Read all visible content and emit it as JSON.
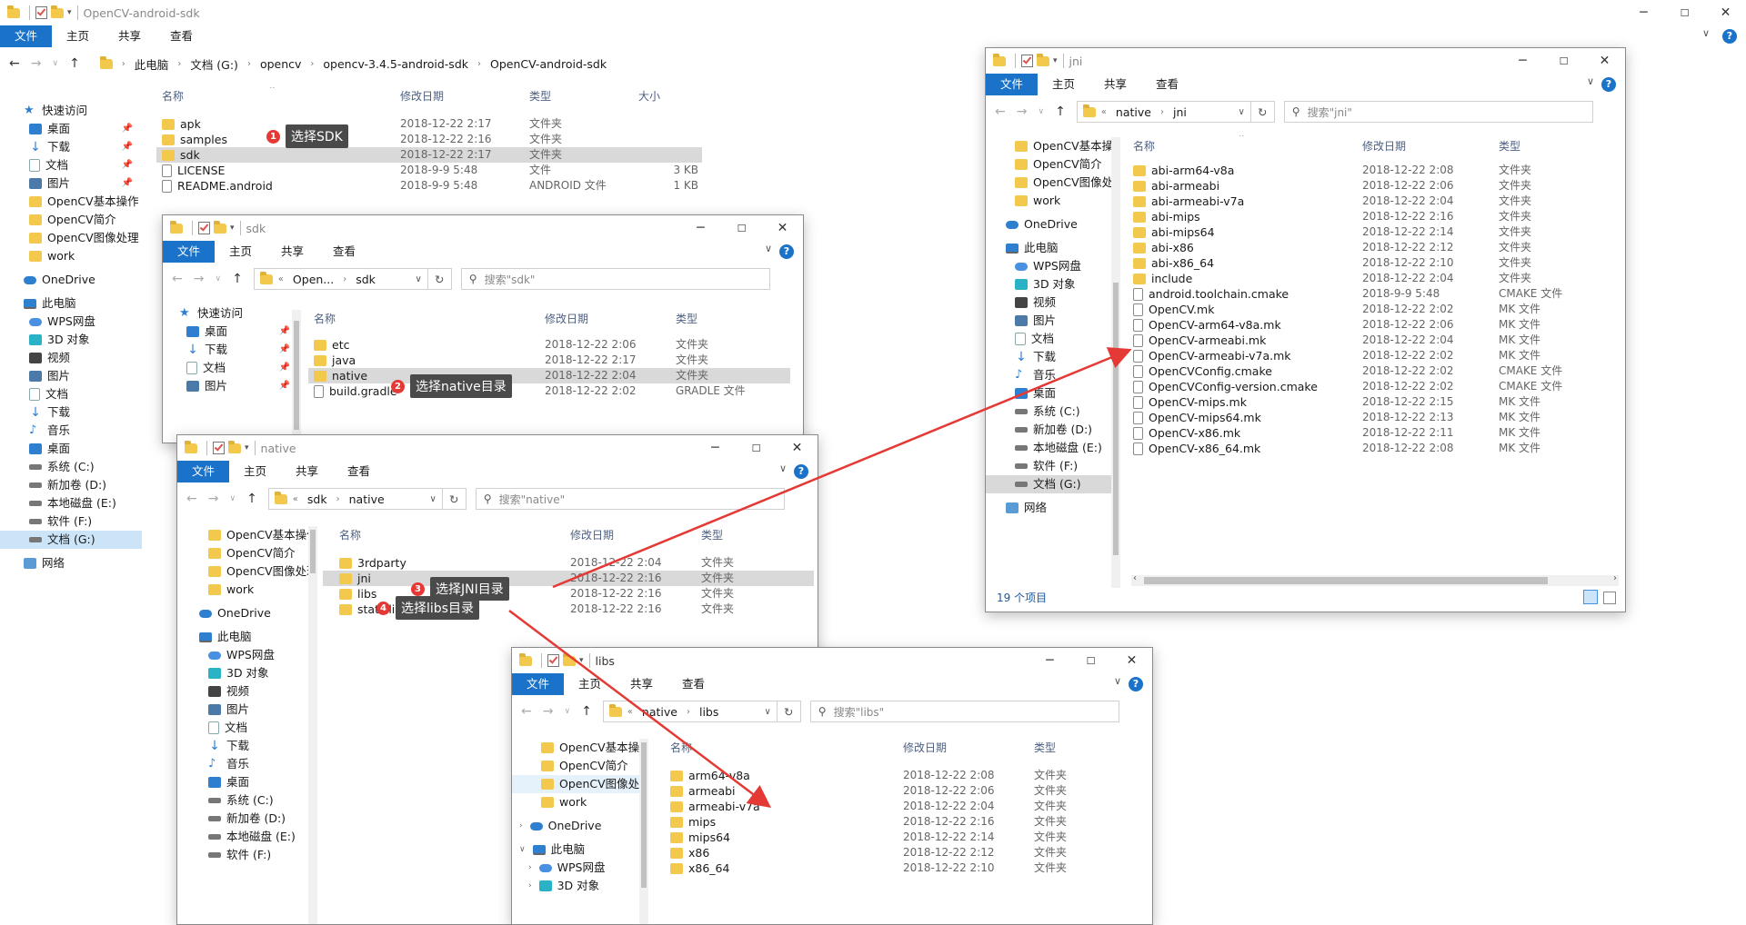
{
  "common": {
    "tab_file": "文件",
    "tab_home": "主页",
    "tab_share": "共享",
    "tab_view": "查看",
    "ctrl_min": "─",
    "ctrl_max": "☐",
    "ctrl_close": "✕"
  },
  "w1": {
    "title": "OpenCV-android-sdk",
    "crumbs": [
      "此电脑",
      "文档 (G:)",
      "opencv",
      "opencv-3.4.5-android-sdk",
      "OpenCV-android-sdk"
    ],
    "headers": {
      "name": "名称",
      "date": "修改日期",
      "type": "类型",
      "size": "大小"
    },
    "rows": [
      {
        "name": "apk",
        "date": "2018-12-22 2:17",
        "type": "文件夹",
        "size": ""
      },
      {
        "name": "samples",
        "date": "2018-12-22 2:16",
        "type": "文件夹",
        "size": ""
      },
      {
        "name": "sdk",
        "date": "2018-12-22 2:17",
        "type": "文件夹",
        "size": ""
      },
      {
        "name": "LICENSE",
        "date": "2018-9-9 5:48",
        "type": "文件",
        "size": "3 KB"
      },
      {
        "name": "README.android",
        "date": "2018-9-9 5:48",
        "type": "ANDROID 文件",
        "size": "1 KB"
      }
    ],
    "nav": [
      "快速访问",
      "桌面",
      "下载",
      "文档",
      "图片",
      "OpenCV基本操作",
      "OpenCV简介",
      "OpenCV图像处理",
      "work",
      "OneDrive",
      "此电脑",
      "WPS网盘",
      "3D 对象",
      "视频",
      "图片",
      "文档",
      "下载",
      "音乐",
      "桌面",
      "系统 (C:)",
      "新加卷 (D:)",
      "本地磁盘 (E:)",
      "软件 (F:)",
      "文档 (G:)",
      "网络"
    ]
  },
  "w2": {
    "title": "sdk",
    "crumbs": [
      "Open...",
      "sdk"
    ],
    "search": "搜索\"sdk\"",
    "headers": {
      "name": "名称",
      "date": "修改日期",
      "type": "类型"
    },
    "rows": [
      {
        "name": "etc",
        "date": "2018-12-22 2:06",
        "type": "文件夹"
      },
      {
        "name": "java",
        "date": "2018-12-22 2:17",
        "type": "文件夹"
      },
      {
        "name": "native",
        "date": "2018-12-22 2:04",
        "type": "文件夹"
      },
      {
        "name": "build.gradle",
        "date": "2018-12-22 2:02",
        "type": "GRADLE 文件"
      }
    ],
    "nav": [
      "快速访问",
      "桌面",
      "下载",
      "文档",
      "图片"
    ]
  },
  "w3": {
    "title": "native",
    "crumbs": [
      "sdk",
      "native"
    ],
    "search": "搜索\"native\"",
    "headers": {
      "name": "名称",
      "date": "修改日期",
      "type": "类型"
    },
    "rows": [
      {
        "name": "3rdparty",
        "date": "2018-12-22 2:04",
        "type": "文件夹"
      },
      {
        "name": "jni",
        "date": "2018-12-22 2:16",
        "type": "文件夹"
      },
      {
        "name": "libs",
        "date": "2018-12-22 2:16",
        "type": "文件夹"
      },
      {
        "name": "staticlibs",
        "date": "2018-12-22 2:16",
        "type": "文件夹"
      }
    ],
    "nav": [
      "OpenCV基本操作",
      "OpenCV简介",
      "OpenCV图像处理",
      "work",
      "OneDrive",
      "此电脑",
      "WPS网盘",
      "3D 对象",
      "视频",
      "图片",
      "文档",
      "下载",
      "音乐",
      "桌面",
      "系统 (C:)",
      "新加卷 (D:)",
      "本地磁盘 (E:)",
      "软件 (F:)"
    ]
  },
  "w4": {
    "title": "libs",
    "crumbs": [
      "native",
      "libs"
    ],
    "search": "搜索\"libs\"",
    "headers": {
      "name": "名称",
      "date": "修改日期",
      "type": "类型"
    },
    "rows": [
      {
        "name": "arm64-v8a",
        "date": "2018-12-22 2:08",
        "type": "文件夹"
      },
      {
        "name": "armeabi",
        "date": "2018-12-22 2:06",
        "type": "文件夹"
      },
      {
        "name": "armeabi-v7a",
        "date": "2018-12-22 2:04",
        "type": "文件夹"
      },
      {
        "name": "mips",
        "date": "2018-12-22 2:16",
        "type": "文件夹"
      },
      {
        "name": "mips64",
        "date": "2018-12-22 2:14",
        "type": "文件夹"
      },
      {
        "name": "x86",
        "date": "2018-12-22 2:12",
        "type": "文件夹"
      },
      {
        "name": "x86_64",
        "date": "2018-12-22 2:10",
        "type": "文件夹"
      }
    ],
    "nav": [
      "OpenCV基本操作",
      "OpenCV简介",
      "OpenCV图像处理",
      "work",
      "OneDrive",
      "此电脑",
      "WPS网盘",
      "3D 对象"
    ]
  },
  "w5": {
    "title": "jni",
    "crumbs": [
      "native",
      "jni"
    ],
    "search": "搜索\"jni\"",
    "status": "19 个项目",
    "headers": {
      "name": "名称",
      "date": "修改日期",
      "type": "类型"
    },
    "rows": [
      {
        "name": "abi-arm64-v8a",
        "date": "2018-12-22 2:08",
        "type": "文件夹",
        "kind": "folder"
      },
      {
        "name": "abi-armeabi",
        "date": "2018-12-22 2:06",
        "type": "文件夹",
        "kind": "folder"
      },
      {
        "name": "abi-armeabi-v7a",
        "date": "2018-12-22 2:04",
        "type": "文件夹",
        "kind": "folder"
      },
      {
        "name": "abi-mips",
        "date": "2018-12-22 2:16",
        "type": "文件夹",
        "kind": "folder"
      },
      {
        "name": "abi-mips64",
        "date": "2018-12-22 2:14",
        "type": "文件夹",
        "kind": "folder"
      },
      {
        "name": "abi-x86",
        "date": "2018-12-22 2:12",
        "type": "文件夹",
        "kind": "folder"
      },
      {
        "name": "abi-x86_64",
        "date": "2018-12-22 2:10",
        "type": "文件夹",
        "kind": "folder"
      },
      {
        "name": "include",
        "date": "2018-12-22 2:04",
        "type": "文件夹",
        "kind": "folder"
      },
      {
        "name": "android.toolchain.cmake",
        "date": "2018-9-9 5:48",
        "type": "CMAKE 文件",
        "kind": "file"
      },
      {
        "name": "OpenCV.mk",
        "date": "2018-12-22 2:02",
        "type": "MK 文件",
        "kind": "file"
      },
      {
        "name": "OpenCV-arm64-v8a.mk",
        "date": "2018-12-22 2:06",
        "type": "MK 文件",
        "kind": "file"
      },
      {
        "name": "OpenCV-armeabi.mk",
        "date": "2018-12-22 2:04",
        "type": "MK 文件",
        "kind": "file"
      },
      {
        "name": "OpenCV-armeabi-v7a.mk",
        "date": "2018-12-22 2:02",
        "type": "MK 文件",
        "kind": "file"
      },
      {
        "name": "OpenCVConfig.cmake",
        "date": "2018-12-22 2:02",
        "type": "CMAKE 文件",
        "kind": "file"
      },
      {
        "name": "OpenCVConfig-version.cmake",
        "date": "2018-12-22 2:02",
        "type": "CMAKE 文件",
        "kind": "file"
      },
      {
        "name": "OpenCV-mips.mk",
        "date": "2018-12-22 2:15",
        "type": "MK 文件",
        "kind": "file"
      },
      {
        "name": "OpenCV-mips64.mk",
        "date": "2018-12-22 2:13",
        "type": "MK 文件",
        "kind": "file"
      },
      {
        "name": "OpenCV-x86.mk",
        "date": "2018-12-22 2:11",
        "type": "MK 文件",
        "kind": "file"
      },
      {
        "name": "OpenCV-x86_64.mk",
        "date": "2018-12-22 2:08",
        "type": "MK 文件",
        "kind": "file"
      }
    ],
    "nav": [
      "OpenCV基本操作",
      "OpenCV简介",
      "OpenCV图像处理",
      "work",
      "OneDrive",
      "此电脑",
      "WPS网盘",
      "3D 对象",
      "视频",
      "图片",
      "文档",
      "下载",
      "音乐",
      "桌面",
      "系统 (C:)",
      "新加卷 (D:)",
      "本地磁盘 (E:)",
      "软件 (F:)",
      "文档 (G:)",
      "网络"
    ]
  },
  "annotations": [
    {
      "num": "1",
      "label": "选择SDK"
    },
    {
      "num": "2",
      "label": "选择native目录"
    },
    {
      "num": "3",
      "label": "选择JNI目录"
    },
    {
      "num": "4",
      "label": "选择libs目录"
    }
  ],
  "colors": {
    "accent": "#1a73c9",
    "badge": "#e53935",
    "arrow": "#e53935"
  }
}
